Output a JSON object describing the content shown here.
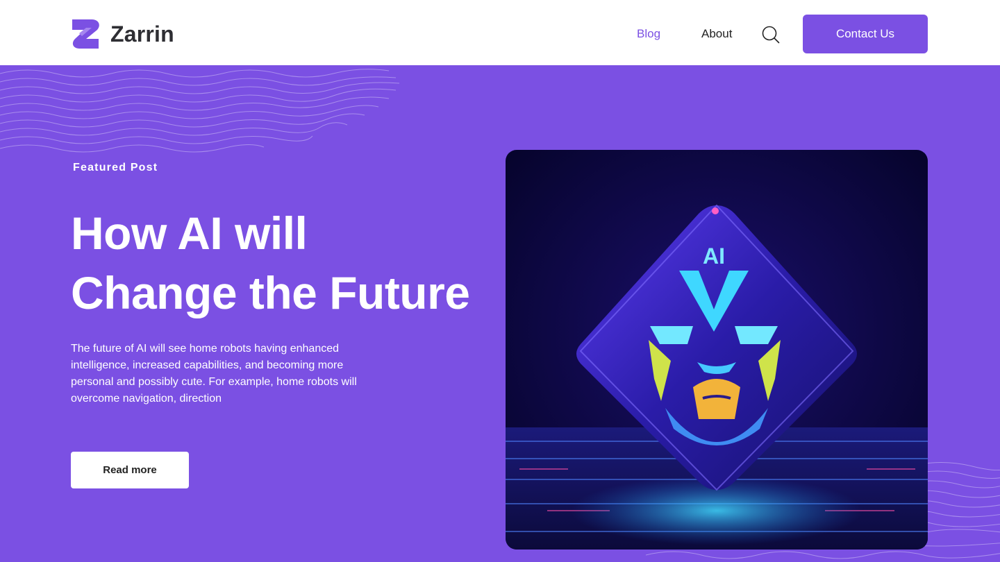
{
  "brand": {
    "name": "Zarrin",
    "logo_icon": "zarrin-logo-icon"
  },
  "nav": {
    "items": [
      {
        "label": "Blog",
        "active": true
      },
      {
        "label": "About",
        "active": false
      }
    ],
    "search_icon": "search-icon",
    "contact_label": "Contact Us"
  },
  "hero": {
    "eyebrow": "Featured Post",
    "title_line1": "How AI will",
    "title_line2": "Change the Future",
    "excerpt": "The future of AI will see home robots having enhanced intelligence, increased capabilities, and becoming more personal and possibly cute. For example, home robots will overcome navigation, direction",
    "read_more_label": "Read more",
    "image_label": "AI"
  },
  "colors": {
    "brand": "#7b50e3",
    "text_dark": "#2e2e33",
    "white": "#ffffff"
  }
}
